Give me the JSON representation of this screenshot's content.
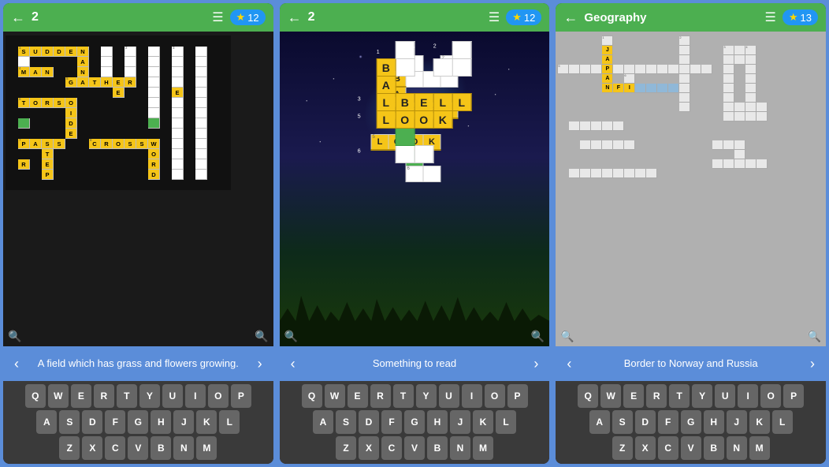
{
  "panels": [
    {
      "id": "panel1",
      "topBar": {
        "backLabel": "←",
        "level": "2",
        "menuIcon": "☰",
        "starCount": "12"
      },
      "clue": "A field which has grass and flowers growing.",
      "keyboard": {
        "row1": [
          "Q",
          "W",
          "E",
          "R",
          "T",
          "Y",
          "U",
          "I",
          "O",
          "P"
        ],
        "row2": [
          "A",
          "S",
          "D",
          "F",
          "G",
          "H",
          "J",
          "K",
          "L"
        ],
        "row3": [
          "Z",
          "X",
          "C",
          "V",
          "B",
          "N",
          "M"
        ]
      }
    },
    {
      "id": "panel2",
      "topBar": {
        "backLabel": "←",
        "level": "2",
        "menuIcon": "☰",
        "starCount": "12"
      },
      "clue": "Something to read",
      "keyboard": {
        "row1": [
          "Q",
          "W",
          "E",
          "R",
          "T",
          "Y",
          "U",
          "I",
          "O",
          "P"
        ],
        "row2": [
          "A",
          "S",
          "D",
          "F",
          "G",
          "H",
          "J",
          "K",
          "L"
        ],
        "row3": [
          "Z",
          "X",
          "C",
          "V",
          "B",
          "N",
          "M"
        ]
      }
    },
    {
      "id": "panel3",
      "topBar": {
        "backLabel": "←",
        "title": "Geography",
        "menuIcon": "☰",
        "starCount": "13"
      },
      "clue": "Border to Norway and Russia",
      "keyboard": {
        "row1": [
          "Q",
          "W",
          "E",
          "R",
          "T",
          "Y",
          "U",
          "I",
          "O",
          "P"
        ],
        "row2": [
          "A",
          "S",
          "D",
          "F",
          "G",
          "H",
          "J",
          "K",
          "L"
        ],
        "row3": [
          "Z",
          "X",
          "C",
          "V",
          "B",
          "N",
          "M"
        ]
      }
    }
  ]
}
